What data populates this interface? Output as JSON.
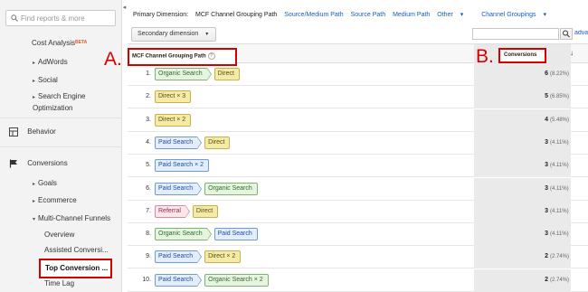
{
  "sidebar": {
    "search_placeholder": "Find reports & more",
    "cost_analysis": "Cost Analysis",
    "beta": "BETA",
    "items": [
      {
        "label": "AdWords"
      },
      {
        "label": "Social"
      },
      {
        "label": "Search Engine Optimization"
      }
    ],
    "behavior": "Behavior",
    "conversions": "Conversions",
    "conv_items": [
      {
        "label": "Goals"
      },
      {
        "label": "Ecommerce"
      },
      {
        "label": "Multi-Channel Funnels"
      }
    ],
    "mcf_items": [
      {
        "label": "Overview"
      },
      {
        "label": "Assisted Conversi..."
      },
      {
        "label": "Top Conversion ..."
      },
      {
        "label": "Time Lag"
      }
    ]
  },
  "dimension_bar": {
    "prefix": "Primary Dimension:",
    "active": "MCF Channel Grouping Path",
    "links": [
      "Source/Medium Path",
      "Source Path",
      "Medium Path"
    ],
    "other": "Other",
    "channel_groupings": "Channel Groupings"
  },
  "secondary_dimension": "Secondary dimension",
  "advanced": "adva",
  "header": {
    "path": "MCF Channel Grouping Path",
    "conversions": "Conversions"
  },
  "labels": {
    "a": "A.",
    "b": "B."
  },
  "rows": [
    {
      "idx": "1.",
      "path": [
        {
          "t": "Organic Search",
          "c": "organic"
        },
        {
          "t": "Direct",
          "c": "direct"
        }
      ],
      "value": "6",
      "pct": "(8.22%)"
    },
    {
      "idx": "2.",
      "path": [
        {
          "t": "Direct × 3",
          "c": "direct"
        }
      ],
      "value": "5",
      "pct": "(6.85%)"
    },
    {
      "idx": "3.",
      "path": [
        {
          "t": "Direct × 2",
          "c": "direct"
        }
      ],
      "value": "4",
      "pct": "(5.48%)"
    },
    {
      "idx": "4.",
      "path": [
        {
          "t": "Paid Search",
          "c": "paid"
        },
        {
          "t": "Direct",
          "c": "direct"
        }
      ],
      "value": "3",
      "pct": "(4.11%)"
    },
    {
      "idx": "5.",
      "path": [
        {
          "t": "Paid Search × 2",
          "c": "paid"
        }
      ],
      "value": "3",
      "pct": "(4.11%)"
    },
    {
      "idx": "6.",
      "path": [
        {
          "t": "Paid Search",
          "c": "paid"
        },
        {
          "t": "Organic Search",
          "c": "organic"
        }
      ],
      "value": "3",
      "pct": "(4.11%)"
    },
    {
      "idx": "7.",
      "path": [
        {
          "t": "Referral",
          "c": "referral"
        },
        {
          "t": "Direct",
          "c": "direct"
        }
      ],
      "value": "3",
      "pct": "(4.11%)"
    },
    {
      "idx": "8.",
      "path": [
        {
          "t": "Organic Search",
          "c": "organic"
        },
        {
          "t": "Paid Search",
          "c": "paid"
        }
      ],
      "value": "3",
      "pct": "(4.11%)"
    },
    {
      "idx": "9.",
      "path": [
        {
          "t": "Paid Search",
          "c": "paid"
        },
        {
          "t": "Direct × 2",
          "c": "direct"
        }
      ],
      "value": "2",
      "pct": "(2.74%)"
    },
    {
      "idx": "10.",
      "path": [
        {
          "t": "Paid Search",
          "c": "paid"
        },
        {
          "t": "Organic Search × 2",
          "c": "organic"
        }
      ],
      "value": "2",
      "pct": "(2.74%)"
    }
  ]
}
